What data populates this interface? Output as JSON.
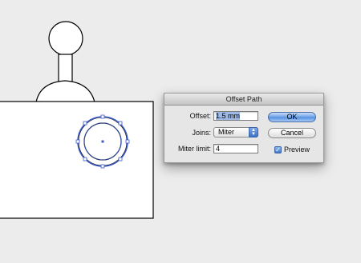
{
  "dialog": {
    "title": "Offset Path",
    "offset_label": "Offset:",
    "offset_value": "1.5 mm",
    "joins_label": "Joins:",
    "joins_value": "Miter",
    "miter_label": "Miter limit:",
    "miter_value": "4",
    "ok_label": "OK",
    "cancel_label": "Cancel",
    "preview_label": "Preview",
    "preview_checked": true
  },
  "colors": {
    "background": "#ececec",
    "selection": "#3b5bd0",
    "accent": "#4f8de0"
  }
}
